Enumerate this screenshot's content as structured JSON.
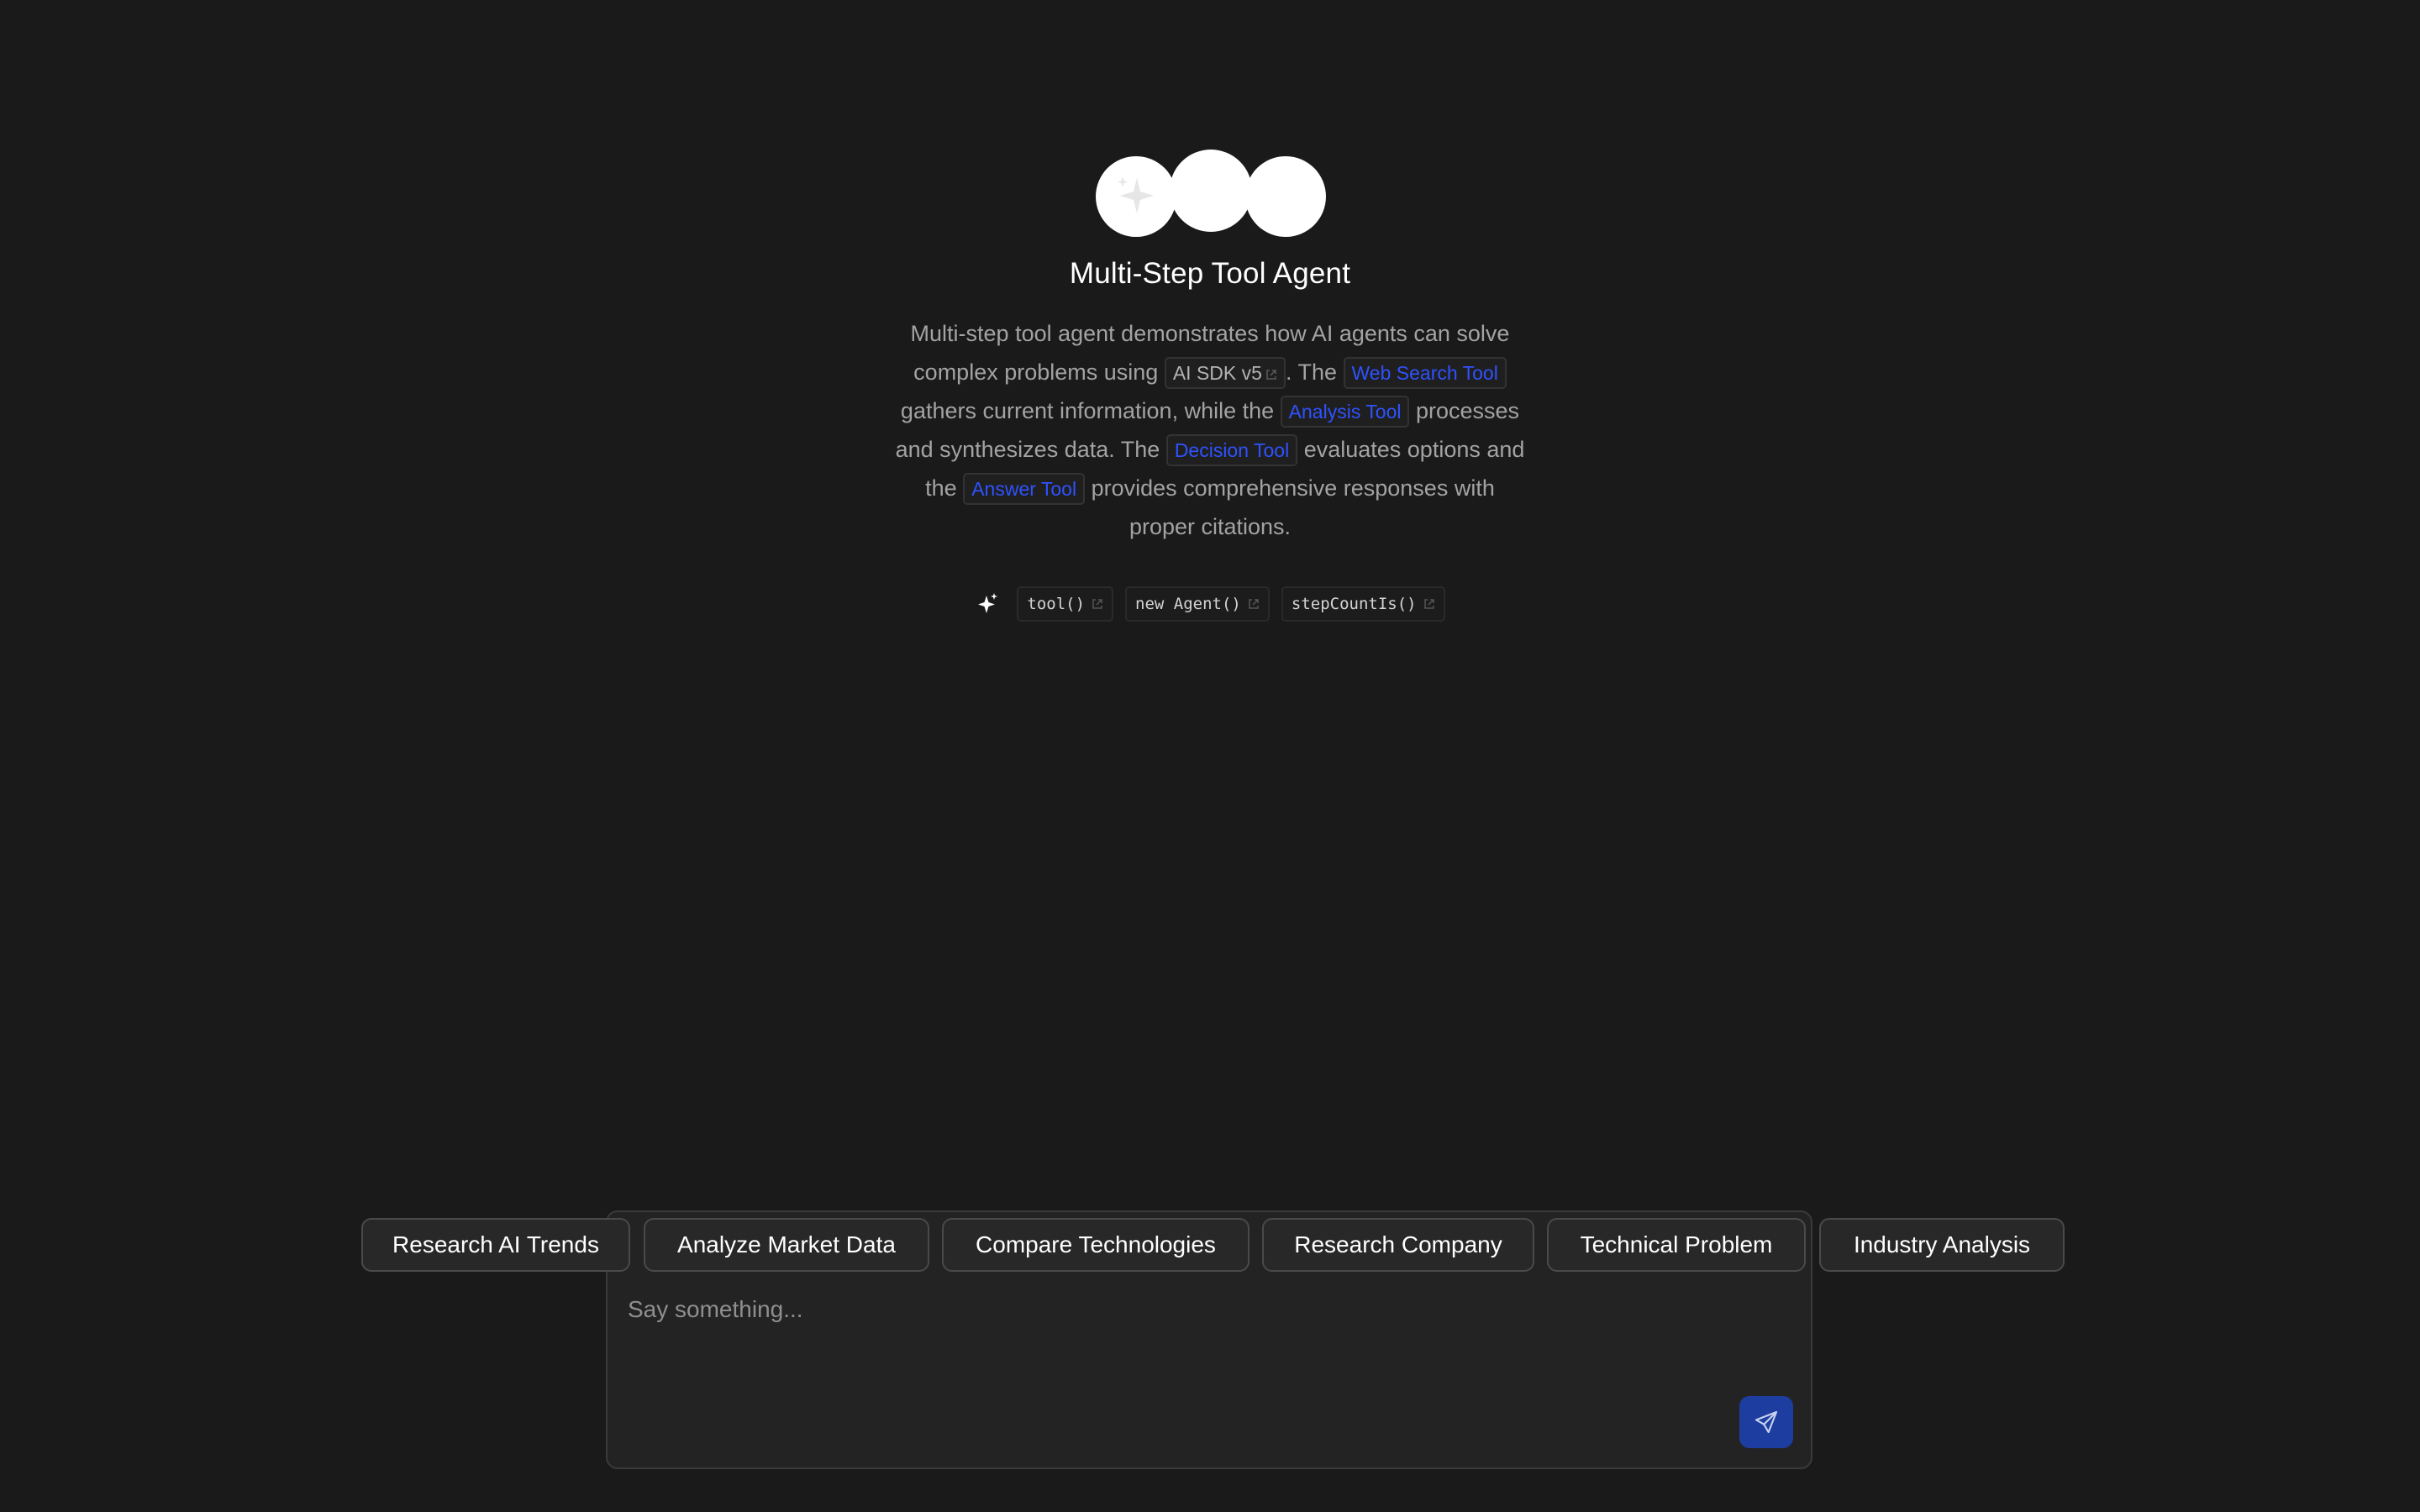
{
  "header": {
    "title": "Multi-Step Tool Agent"
  },
  "description": {
    "line1_a": "Multi-step tool agent demonstrates how AI agents can solve complex problems using",
    "sdk_link": "AI SDK v5",
    "line1_b": ". The",
    "web_search_tool": "Web Search Tool",
    "line2": "gathers current information, while the",
    "analysis_tool": "Analysis Tool",
    "line3": "processes and synthesizes data. The",
    "decision_tool": "Decision Tool",
    "line4": "evaluates options and the",
    "answer_tool": "Answer Tool",
    "line5": "provides comprehensive responses with proper citations."
  },
  "api_links": [
    "tool()",
    "new Agent()",
    "stepCountIs()"
  ],
  "suggestions": [
    "Research AI Trends",
    "Analyze Market Data",
    "Compare Technologies",
    "Research Company",
    "Technical Problem",
    "Industry Analysis"
  ],
  "input": {
    "placeholder": "Say something..."
  },
  "icons": {
    "logo": "sparkle-icon",
    "api": "sparkles-icon",
    "send": "send-icon",
    "external": "external-link-icon"
  },
  "colors": {
    "background": "#1a1a1a",
    "link_blue": "#2f52ff",
    "send_button": "#1d3ea0"
  }
}
